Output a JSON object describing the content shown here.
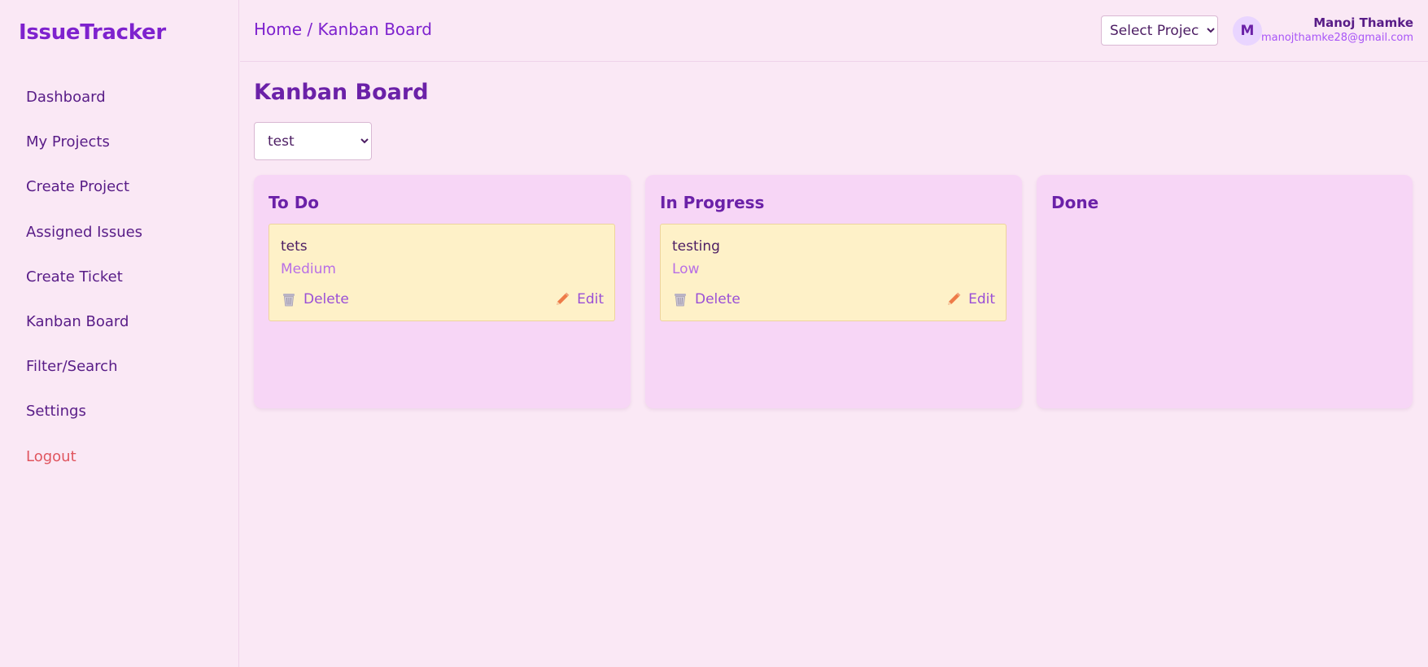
{
  "app": {
    "brand": "IssueTracker"
  },
  "sidebar": {
    "items": [
      {
        "label": "Dashboard"
      },
      {
        "label": "My Projects"
      },
      {
        "label": "Create Project"
      },
      {
        "label": "Assigned Issues"
      },
      {
        "label": "Create Ticket"
      },
      {
        "label": "Kanban Board"
      },
      {
        "label": "Filter/Search"
      },
      {
        "label": "Settings"
      },
      {
        "label": "Logout"
      }
    ]
  },
  "header": {
    "breadcrumb": "Home / Kanban Board",
    "project_select": "Select Project",
    "avatar_initial": "M",
    "user_name": "Manoj Thamke",
    "user_email": "manojthamke28@gmail.com"
  },
  "main": {
    "title": "Kanban Board",
    "board_select": "test",
    "delete_label": "Delete",
    "edit_label": "Edit",
    "columns": [
      {
        "title": "To Do",
        "cards": [
          {
            "title": "tets",
            "priority": "Medium"
          }
        ]
      },
      {
        "title": "In Progress",
        "cards": [
          {
            "title": "testing",
            "priority": "Low"
          }
        ]
      },
      {
        "title": "Done",
        "cards": []
      }
    ]
  },
  "colors": {
    "accent": "#7e22ce",
    "background": "#fae8f5",
    "column": "#f7d6f6",
    "card": "#fef1c8",
    "logout": "#e0555f"
  },
  "icons": {
    "delete": "trash-icon",
    "edit": "pencil-icon",
    "select": "chevron-down-icon"
  }
}
